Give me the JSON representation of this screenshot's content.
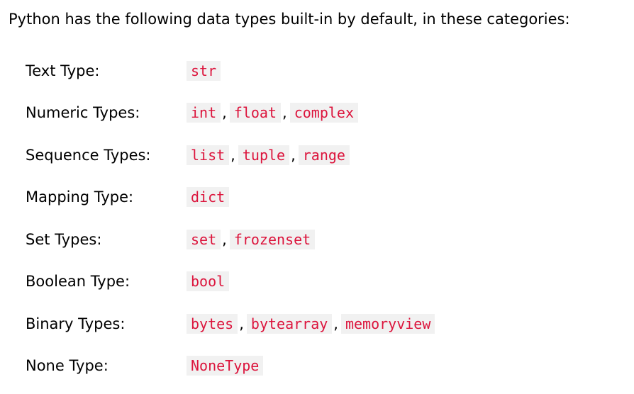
{
  "intro": "Python has the following data types built-in by default, in these categories:",
  "colors": {
    "code_text": "#dc143c",
    "code_background": "#f1f1f1"
  },
  "categories": [
    {
      "label": "Text Type:",
      "types": [
        "str"
      ]
    },
    {
      "label": "Numeric Types:",
      "types": [
        "int",
        "float",
        "complex"
      ]
    },
    {
      "label": "Sequence Types:",
      "types": [
        "list",
        "tuple",
        "range"
      ]
    },
    {
      "label": "Mapping Type:",
      "types": [
        "dict"
      ]
    },
    {
      "label": "Set Types:",
      "types": [
        "set",
        "frozenset"
      ]
    },
    {
      "label": "Boolean Type:",
      "types": [
        "bool"
      ]
    },
    {
      "label": "Binary Types:",
      "types": [
        "bytes",
        "bytearray",
        "memoryview"
      ]
    },
    {
      "label": "None Type:",
      "types": [
        "NoneType"
      ]
    }
  ],
  "separator": ","
}
